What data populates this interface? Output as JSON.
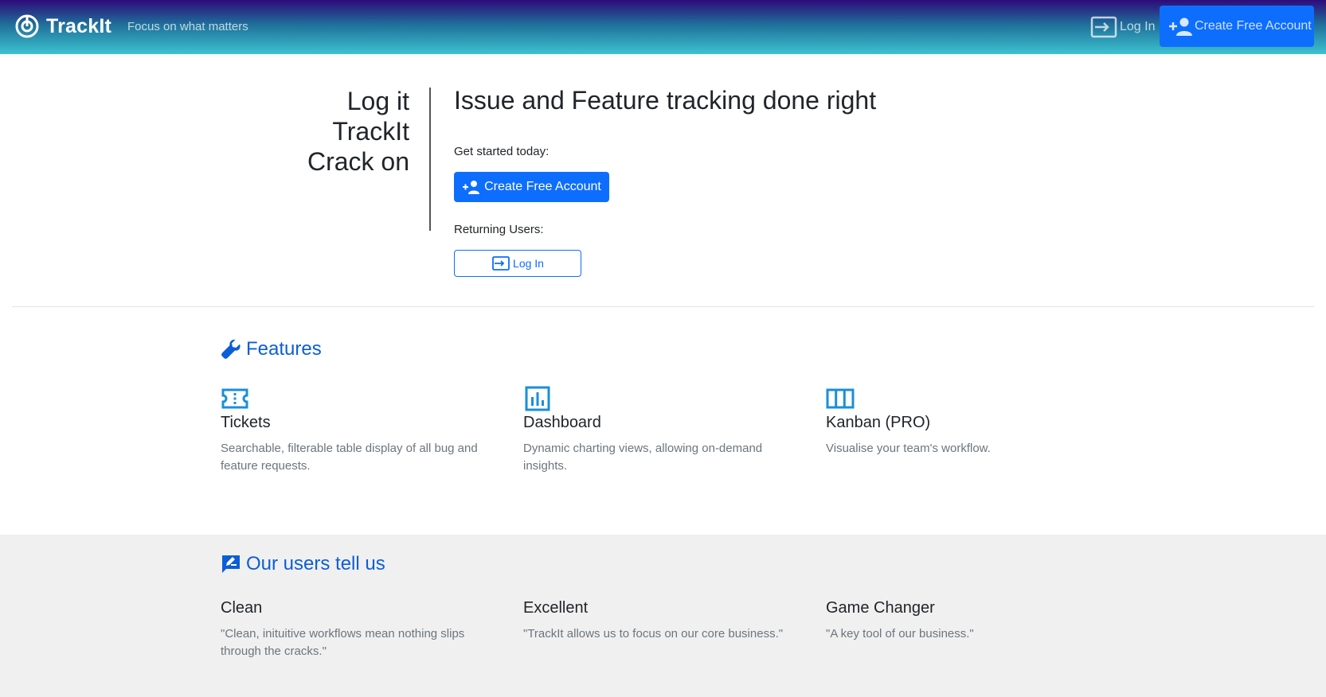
{
  "navbar": {
    "brand_name": "TrackIt",
    "tagline": "Focus on what matters",
    "login_label": "Log In",
    "create_account_label": "Create Free Account"
  },
  "hero": {
    "slogan_lines": [
      "Log it",
      "TrackIt",
      "Crack on"
    ],
    "title": "Issue and Feature tracking done right",
    "get_started_label": "Get started today:",
    "create_account_label": "Create Free Account",
    "returning_label": "Returning Users:",
    "login_label": "Log In"
  },
  "features": {
    "title": "Features",
    "items": [
      {
        "icon": "ticket-icon",
        "heading": "Tickets",
        "text": "Searchable, filterable table display of all bug and feature requests."
      },
      {
        "icon": "chart-icon",
        "heading": "Dashboard",
        "text": "Dynamic charting views, allowing on-demand insights."
      },
      {
        "icon": "kanban-icon",
        "heading": "Kanban (PRO)",
        "text": "Visualise your team's workflow."
      }
    ]
  },
  "testimonials": {
    "title": "Our users tell us",
    "items": [
      {
        "heading": "Clean",
        "text": "\"Clean, inituitive workflows mean nothing slips through the cracks.\""
      },
      {
        "heading": "Excellent",
        "text": "\"TrackIt allows us to focus on our core business.\""
      },
      {
        "heading": "Game Changer",
        "text": "\"A key tool of our business.\""
      }
    ]
  },
  "colors": {
    "primary": "#0d6efd",
    "section_title": "#0b5ed7",
    "nav_gradient_top": "#2e0a7a",
    "nav_gradient_bottom": "#3cc3cf"
  }
}
